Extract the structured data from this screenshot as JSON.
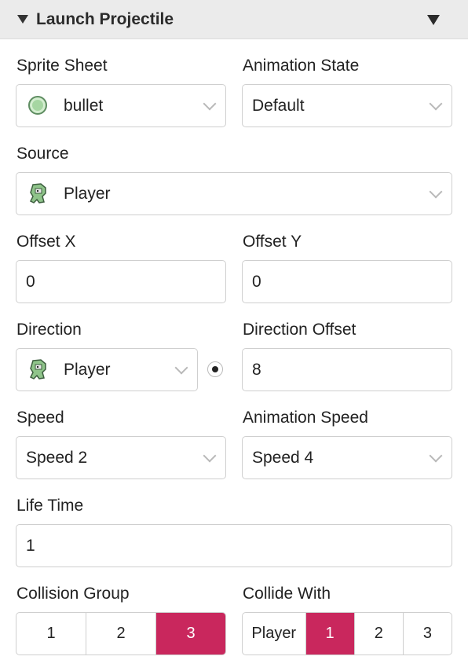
{
  "header": {
    "title": "Launch Projectile",
    "collapse_icon": "triangle-down-icon",
    "menu_icon": "triangle-down-icon"
  },
  "sprite_sheet": {
    "label": "Sprite Sheet",
    "value": "bullet",
    "icon": "bullet-sprite-icon"
  },
  "animation_state": {
    "label": "Animation State",
    "value": "Default"
  },
  "source": {
    "label": "Source",
    "value": "Player",
    "icon": "player-sprite-icon"
  },
  "offset_x": {
    "label": "Offset X",
    "value": "0"
  },
  "offset_y": {
    "label": "Offset Y",
    "value": "0"
  },
  "direction": {
    "label": "Direction",
    "value": "Player",
    "icon": "player-sprite-icon",
    "radio_selected": true
  },
  "direction_offset": {
    "label": "Direction Offset",
    "value": "8"
  },
  "speed": {
    "label": "Speed",
    "value": "Speed 2"
  },
  "animation_speed": {
    "label": "Animation Speed",
    "value": "Speed 4"
  },
  "life_time": {
    "label": "Life Time",
    "value": "1"
  },
  "collision_group": {
    "label": "Collision Group",
    "options": [
      "1",
      "2",
      "3"
    ],
    "selected": "3"
  },
  "collide_with": {
    "label": "Collide With",
    "options": [
      "Player",
      "1",
      "2",
      "3"
    ],
    "selected": [
      "1"
    ]
  },
  "colors": {
    "accent": "#c9275d",
    "header_bg": "#ebebeb",
    "border": "#cfcfcf"
  }
}
